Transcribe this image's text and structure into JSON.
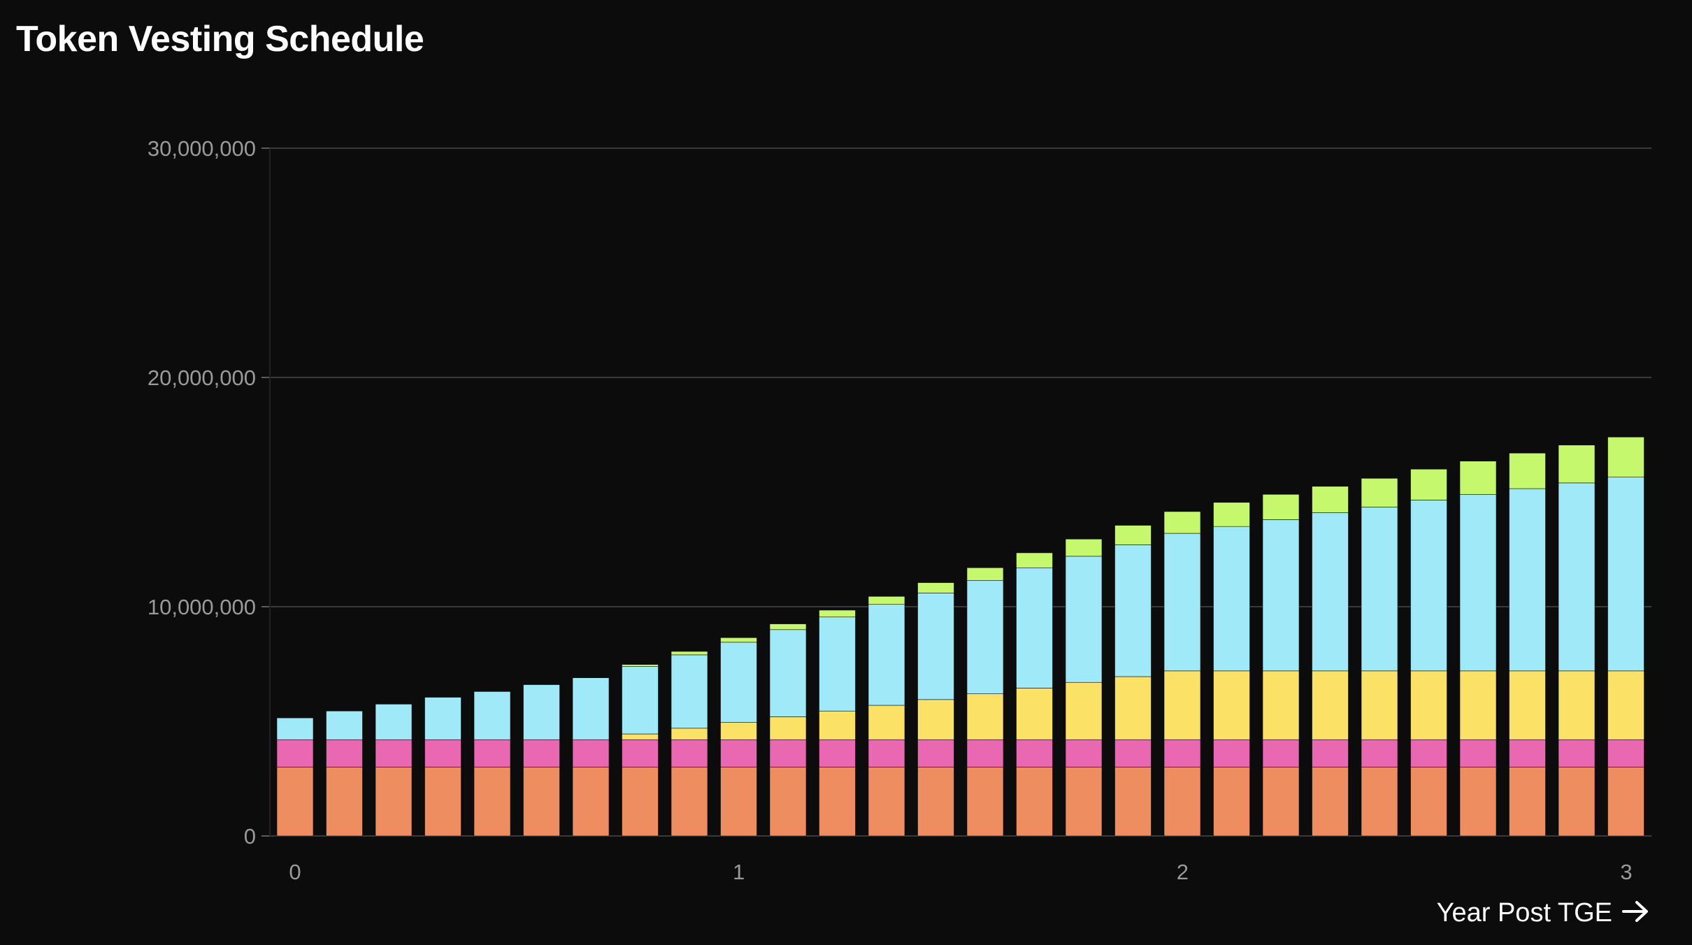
{
  "chart_data": {
    "type": "bar",
    "stacked": true,
    "title": "Token Vesting Schedule",
    "xlabel": "Year Post TGE",
    "ylabel": "",
    "ylim": [
      0,
      30000000
    ],
    "yticks": [
      0,
      10000000,
      20000000,
      30000000
    ],
    "ytick_labels": [
      "0",
      "10,000,000",
      "20,000,000",
      "30,000,000"
    ],
    "xlim": [
      0,
      3
    ],
    "xticks": [
      0,
      1,
      2,
      3
    ],
    "xtick_labels": [
      "0",
      "1",
      "2",
      "3"
    ],
    "grid": "horizontal",
    "legend": "none",
    "x": [
      0,
      0.083,
      0.167,
      0.25,
      0.333,
      0.417,
      0.5,
      0.583,
      0.667,
      0.75,
      0.833,
      0.917,
      1,
      1.083,
      1.167,
      1.25,
      1.333,
      1.417,
      1.5,
      1.583,
      1.667,
      1.75,
      1.833,
      1.917,
      2,
      2.083,
      2.167,
      2.25,
      2.333,
      2.417,
      2.5,
      2.583,
      2.667,
      2.75,
      2.833,
      2.917,
      3
    ],
    "series": [
      {
        "color": "#ee8d5f",
        "values": [
          3000000,
          3000000,
          3000000,
          3000000,
          3000000,
          3000000,
          3000000,
          3000000,
          3000000,
          3000000,
          3000000,
          3000000,
          3000000,
          3000000,
          3000000,
          3000000,
          3000000,
          3000000,
          3000000,
          3000000,
          3000000,
          3000000,
          3000000,
          3000000,
          3000000,
          3000000,
          3000000,
          3000000
        ]
      },
      {
        "color": "#e968b1",
        "values": [
          1200000,
          1200000,
          1200000,
          1200000,
          1200000,
          1200000,
          1200000,
          1200000,
          1200000,
          1200000,
          1200000,
          1200000,
          1200000,
          1200000,
          1200000,
          1200000,
          1200000,
          1200000,
          1200000,
          1200000,
          1200000,
          1200000,
          1200000,
          1200000,
          1200000,
          1200000,
          1200000,
          1200000
        ]
      },
      {
        "color": "#fbe166",
        "values": [
          0,
          0,
          0,
          0,
          0,
          0,
          0,
          250000,
          500000,
          750000,
          1000000,
          1250000,
          1500000,
          1750000,
          2000000,
          2250000,
          2500000,
          2750000,
          3000000,
          3000000,
          3000000,
          3000000,
          3000000,
          3000000,
          3000000,
          3000000,
          3000000,
          3000000
        ]
      },
      {
        "color": "#a0e9f9",
        "values": [
          950000,
          1250000,
          1550000,
          1850000,
          2100000,
          2400000,
          2700000,
          2950000,
          3200000,
          3500000,
          3800000,
          4100000,
          4400000,
          4650000,
          4950000,
          5250000,
          5500000,
          5750000,
          6000000,
          6300000,
          6600000,
          6900000,
          7150000,
          7450000,
          7700000,
          7950000,
          8200000,
          8450000
        ]
      },
      {
        "color": "#c6f86d",
        "values": [
          0,
          0,
          0,
          0,
          0,
          0,
          0,
          80000,
          150000,
          200000,
          250000,
          300000,
          350000,
          450000,
          550000,
          650000,
          750000,
          850000,
          950000,
          1050000,
          1100000,
          1150000,
          1250000,
          1350000,
          1450000,
          1550000,
          1650000,
          1750000
        ]
      }
    ]
  }
}
